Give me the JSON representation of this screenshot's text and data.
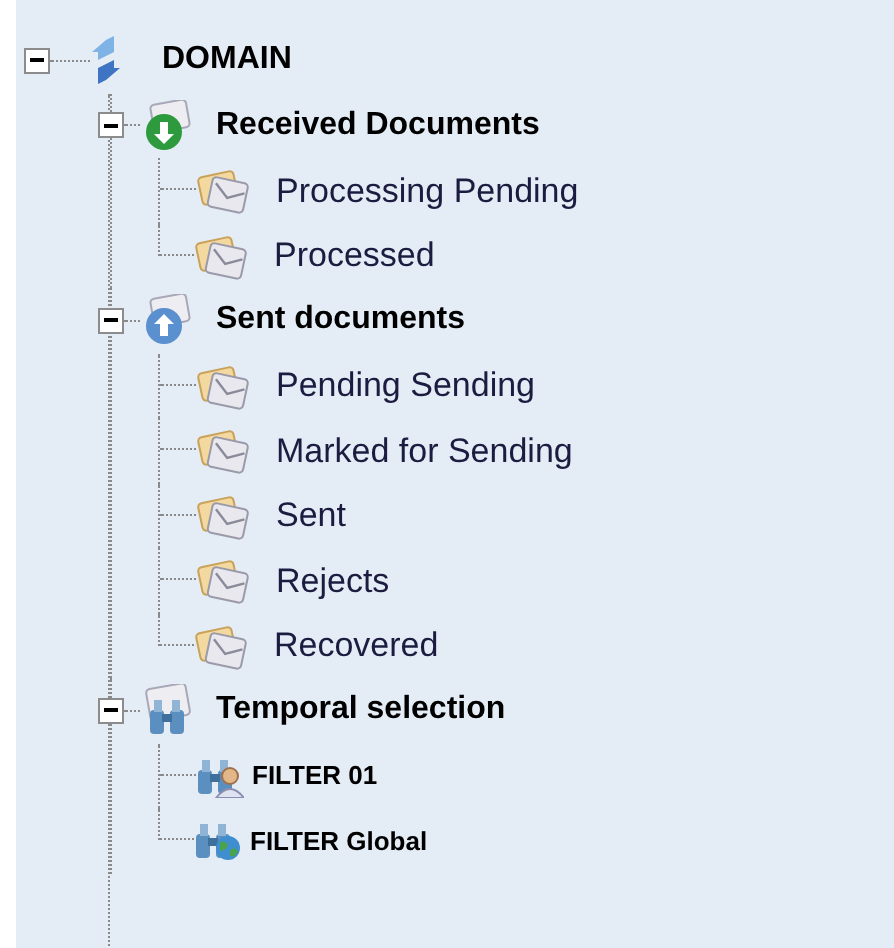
{
  "tree": {
    "label": "DOMAIN",
    "kind": "domain",
    "expanded": true,
    "children": [
      {
        "label": "Received Documents",
        "kind": "received",
        "expanded": true,
        "children": [
          {
            "label": "Processing Pending",
            "kind": "envelope"
          },
          {
            "label": "Processed",
            "kind": "envelope"
          }
        ]
      },
      {
        "label": "Sent documents",
        "kind": "sent",
        "expanded": true,
        "children": [
          {
            "label": "Pending Sending",
            "kind": "envelope"
          },
          {
            "label": "Marked for Sending",
            "kind": "envelope"
          },
          {
            "label": "Sent",
            "kind": "envelope"
          },
          {
            "label": "Rejects",
            "kind": "envelope"
          },
          {
            "label": "Recovered",
            "kind": "envelope"
          }
        ]
      },
      {
        "label": "Temporal selection",
        "kind": "search",
        "expanded": true,
        "children": [
          {
            "label": "FILTER 01",
            "kind": "filter-user"
          },
          {
            "label": "FILTER Global",
            "kind": "filter-global"
          }
        ]
      }
    ]
  }
}
